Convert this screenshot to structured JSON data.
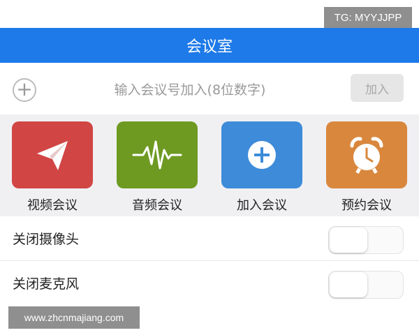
{
  "overlay": {
    "tg_label": "TG: MYYJJPP",
    "site_watermark": "www.zhcnmajiang.com"
  },
  "header": {
    "title": "会议室",
    "color": "#1e7ae8"
  },
  "join": {
    "add_icon": "plus-circle-icon",
    "placeholder": "输入会议号加入(8位数字)",
    "button_label": "加入"
  },
  "tiles": [
    {
      "label": "视频会议",
      "icon": "paper-plane-icon",
      "color": "#d14545"
    },
    {
      "label": "音频会议",
      "icon": "waveform-icon",
      "color": "#6e9a22"
    },
    {
      "label": "加入会议",
      "icon": "plus-circle-icon",
      "color": "#3d8bd9"
    },
    {
      "label": "预约会议",
      "icon": "alarm-clock-icon",
      "color": "#d9873d"
    }
  ],
  "settings": [
    {
      "label": "关闭摄像头",
      "on": false
    },
    {
      "label": "关闭麦克风",
      "on": false
    }
  ]
}
